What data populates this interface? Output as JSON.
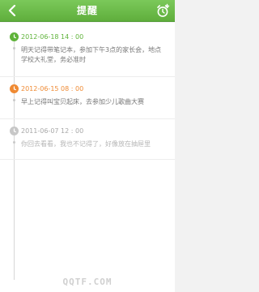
{
  "header": {
    "title": "提醒"
  },
  "entries": [
    {
      "datetime": "2012-06-18  14 : 00",
      "text": "明天记得带笔记本，参加下午3点的家长会，地点学校大礼堂，务必准时",
      "status": "green"
    },
    {
      "datetime": "2012-06-15  08 : 00",
      "text": "早上记得叫宝贝起床，去参加少儿歌曲大赛",
      "status": "orange"
    },
    {
      "datetime": "2011-06-07  12 : 00",
      "text": "你回去看看，我也不记得了，好像放在抽屉里",
      "status": "gray"
    }
  ],
  "colors": {
    "accent": "#5fb33a",
    "warning": "#ef8a33",
    "past": "#c7c7c7"
  },
  "icons": {
    "back": "back-arrow-icon",
    "add": "add-alarm-icon",
    "node": "clock-icon"
  },
  "watermark": "QQTF.COM"
}
